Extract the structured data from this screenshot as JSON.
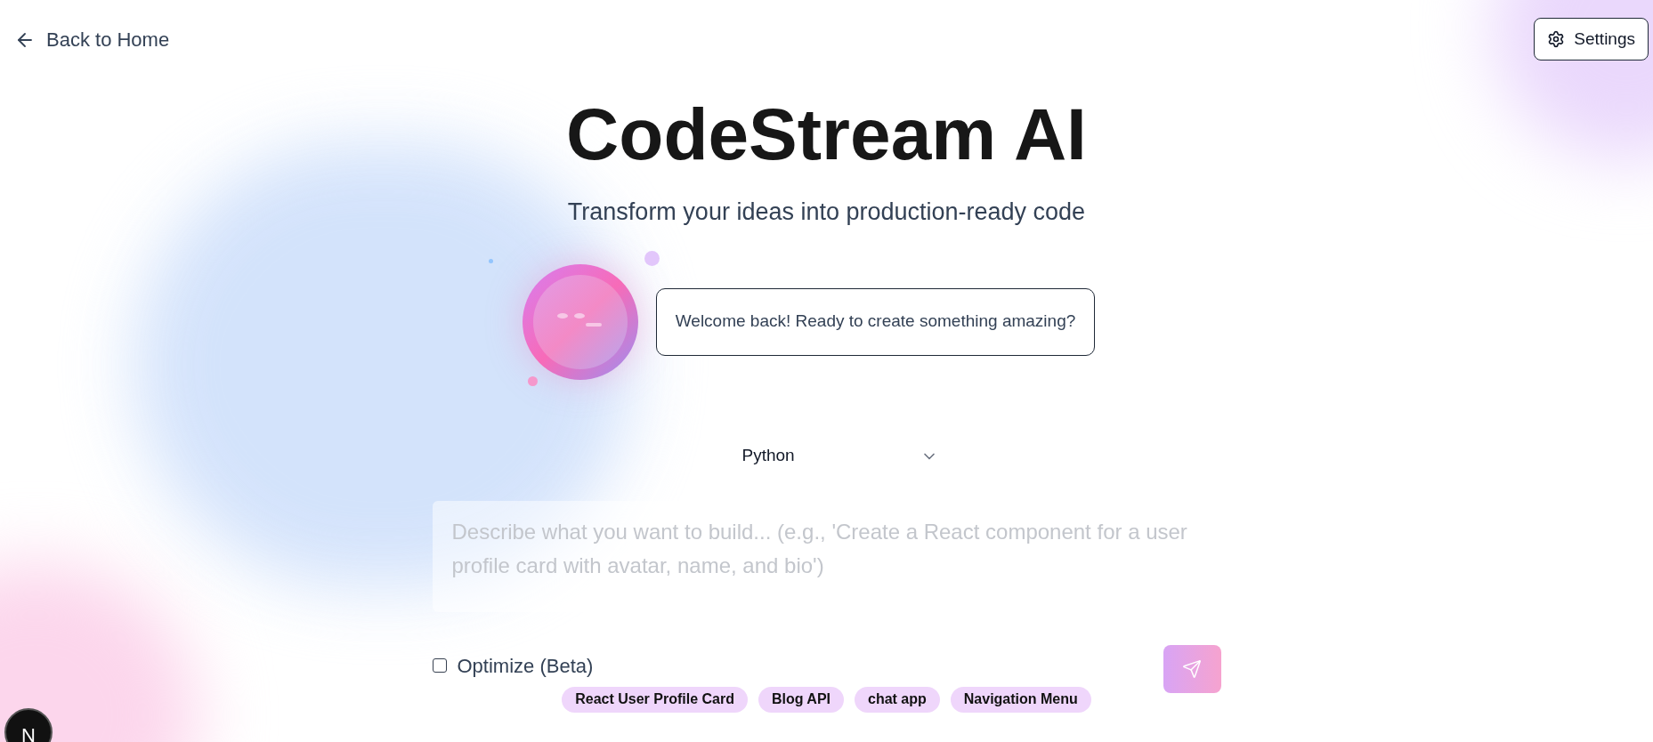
{
  "nav": {
    "back_link": "Back to Home",
    "settings_button": "Settings"
  },
  "hero": {
    "title": "CodeStream AI",
    "subtitle": "Transform your ideas into production-ready code"
  },
  "assistant": {
    "message": "Welcome back! Ready to create something amazing?"
  },
  "language_select": {
    "value": "Python"
  },
  "prompt": {
    "placeholder": "Describe what you want to build... (e.g., 'Create a React component for a user profile card with avatar, name, and bio')"
  },
  "optimize": {
    "label": "Optimize (Beta)",
    "checked": false
  },
  "send_button": {
    "disabled": true
  },
  "suggestions": [
    {
      "label": "React User Profile Card"
    },
    {
      "label": "Blog API"
    },
    {
      "label": "chat app"
    },
    {
      "label": "Navigation Menu"
    }
  ],
  "dev_badge": "N"
}
